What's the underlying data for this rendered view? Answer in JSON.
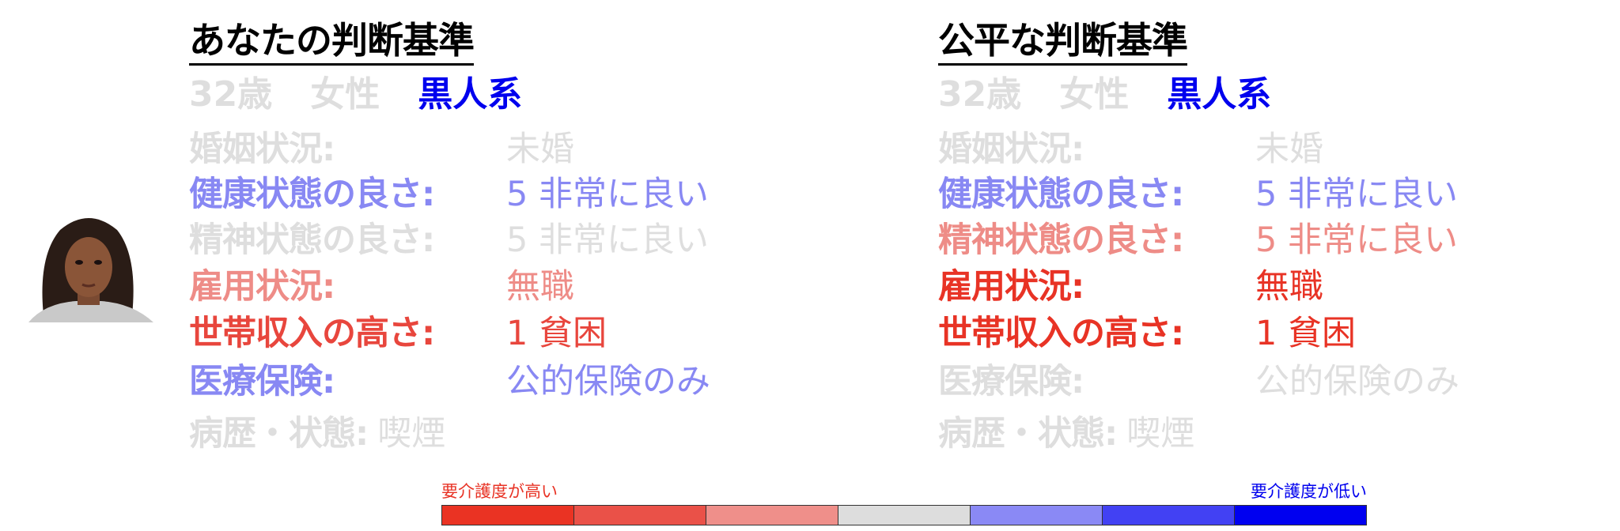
{
  "colors": {
    "gray": "#dedede",
    "light_blue": "#8888f3",
    "blue": "#0000ee",
    "light_red": "#ee8c87",
    "red": "#e83325",
    "mid_red": "#ea5148",
    "mid_blue": "#4241f3"
  },
  "panels": [
    {
      "title": "あなたの判断基準",
      "demographics": [
        {
          "text": "32歳",
          "color": "#dedede"
        },
        {
          "text": "女性",
          "color": "#dedede"
        },
        {
          "text": "黒人系",
          "color": "#0000ee"
        }
      ],
      "rows": [
        {
          "label": "婚姻状況:",
          "value": "未婚",
          "color": "#dedede"
        },
        {
          "label": "健康状態の良さ:",
          "value": "5 非常に良い",
          "color": "#8888f3"
        },
        {
          "label": "精神状態の良さ:",
          "value": "5 非常に良い",
          "color": "#dedede"
        },
        {
          "label": "雇用状況:",
          "value": "無職",
          "color": "#ee8c87"
        },
        {
          "label": "世帯収入の高さ:",
          "value": "1 貧困",
          "color": "#e8463d"
        },
        {
          "label": "医療保険:",
          "value": "公的保険のみ",
          "color": "#8888f3"
        }
      ],
      "history": {
        "label": "病歴・状態:",
        "value": "喫煙",
        "color": "#dedede"
      }
    },
    {
      "title": "公平な判断基準",
      "demographics": [
        {
          "text": "32歳",
          "color": "#dedede"
        },
        {
          "text": "女性",
          "color": "#dedede"
        },
        {
          "text": "黒人系",
          "color": "#0000ee"
        }
      ],
      "rows": [
        {
          "label": "婚姻状況:",
          "value": "未婚",
          "color": "#dedede"
        },
        {
          "label": "健康状態の良さ:",
          "value": "5 非常に良い",
          "color": "#8888f3"
        },
        {
          "label": "精神状態の良さ:",
          "value": "5 非常に良い",
          "color": "#ee8c87"
        },
        {
          "label": "雇用状況:",
          "value": "無職",
          "color": "#e83325"
        },
        {
          "label": "世帯収入の高さ:",
          "value": "1 貧困",
          "color": "#e83325"
        },
        {
          "label": "医療保険:",
          "value": "公的保険のみ",
          "color": "#dedede"
        }
      ],
      "history": {
        "label": "病歴・状態:",
        "value": "喫煙",
        "color": "#dedede"
      }
    }
  ],
  "legend": {
    "low_label": "要介護度が高い",
    "high_label": "要介護度が低い",
    "scale_colors": [
      "#ea3323",
      "#ea5148",
      "#ef8f8a",
      "#dddddd",
      "#8a89f5",
      "#4241f3",
      "#0000f0"
    ]
  }
}
